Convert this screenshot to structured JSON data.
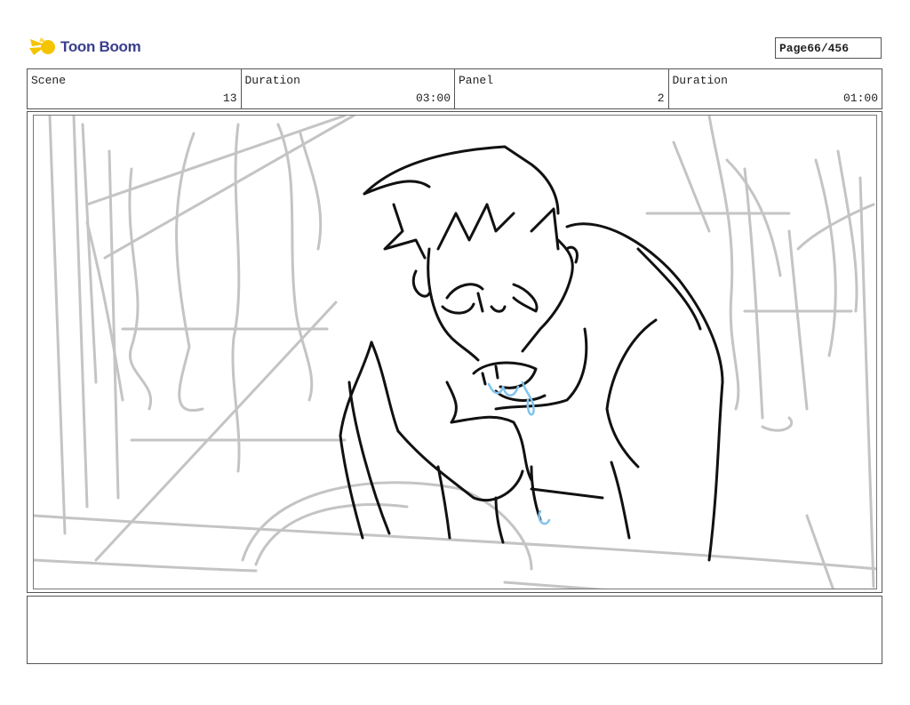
{
  "header": {
    "logo_text": "Toon Boom",
    "page_label": "Page",
    "page_value": "66/456"
  },
  "info": {
    "scene_label": "Scene",
    "scene_value": "13",
    "scene_duration_label": "Duration",
    "scene_duration_value": "03:00",
    "panel_label": "Panel",
    "panel_value": "2",
    "panel_duration_label": "Duration",
    "panel_duration_value": "01:00"
  },
  "notes": {
    "text": ""
  },
  "colors": {
    "border": "#555555",
    "sketch_ink": "#111111",
    "sketch_background": "#c4c4c4",
    "sketch_blue": "#7fc4ee",
    "logo_yellow": "#f5c400",
    "logo_text": "#3a3f8c"
  }
}
